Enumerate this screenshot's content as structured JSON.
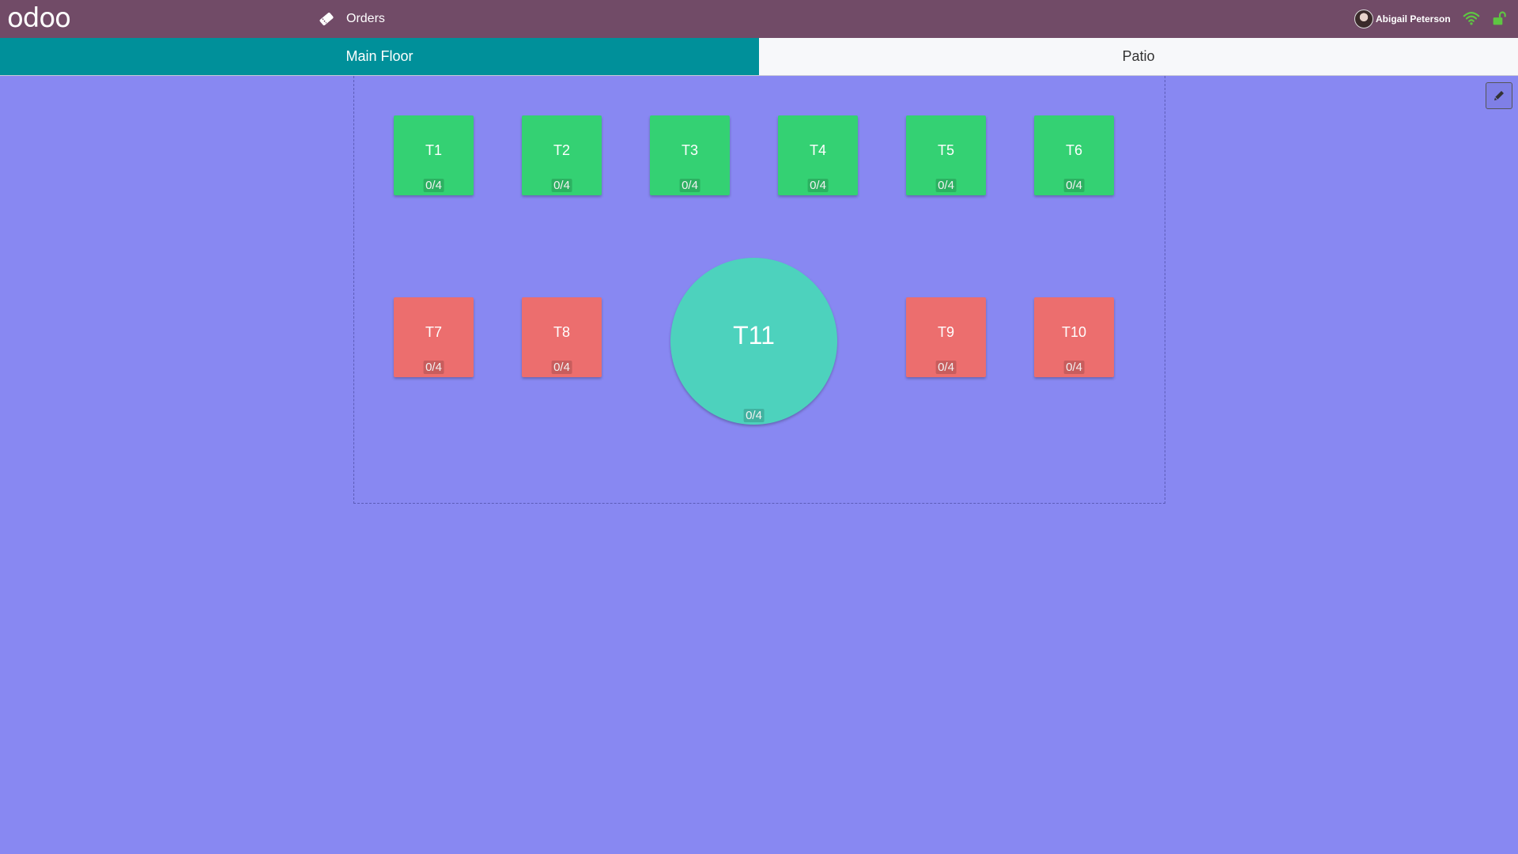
{
  "header": {
    "logo_text": "odoo",
    "orders_label": "Orders",
    "user_name": "Abigail Peterson",
    "colors": {
      "bar": "#714b67",
      "wifi": "#5ec642",
      "lock": "#5ec642"
    }
  },
  "tabs": [
    {
      "label": "Main Floor",
      "active": true
    },
    {
      "label": "Patio",
      "active": false
    }
  ],
  "floor": {
    "tables": [
      {
        "name": "T1",
        "seats": "0/4",
        "status": "green"
      },
      {
        "name": "T2",
        "seats": "0/4",
        "status": "green"
      },
      {
        "name": "T3",
        "seats": "0/4",
        "status": "green"
      },
      {
        "name": "T4",
        "seats": "0/4",
        "status": "green"
      },
      {
        "name": "T5",
        "seats": "0/4",
        "status": "green"
      },
      {
        "name": "T6",
        "seats": "0/4",
        "status": "green"
      },
      {
        "name": "T7",
        "seats": "0/4",
        "status": "red"
      },
      {
        "name": "T8",
        "seats": "0/4",
        "status": "red"
      },
      {
        "name": "T11",
        "seats": "0/4",
        "status": "teal",
        "shape": "round"
      },
      {
        "name": "T9",
        "seats": "0/4",
        "status": "red"
      },
      {
        "name": "T10",
        "seats": "0/4",
        "status": "red"
      }
    ]
  }
}
